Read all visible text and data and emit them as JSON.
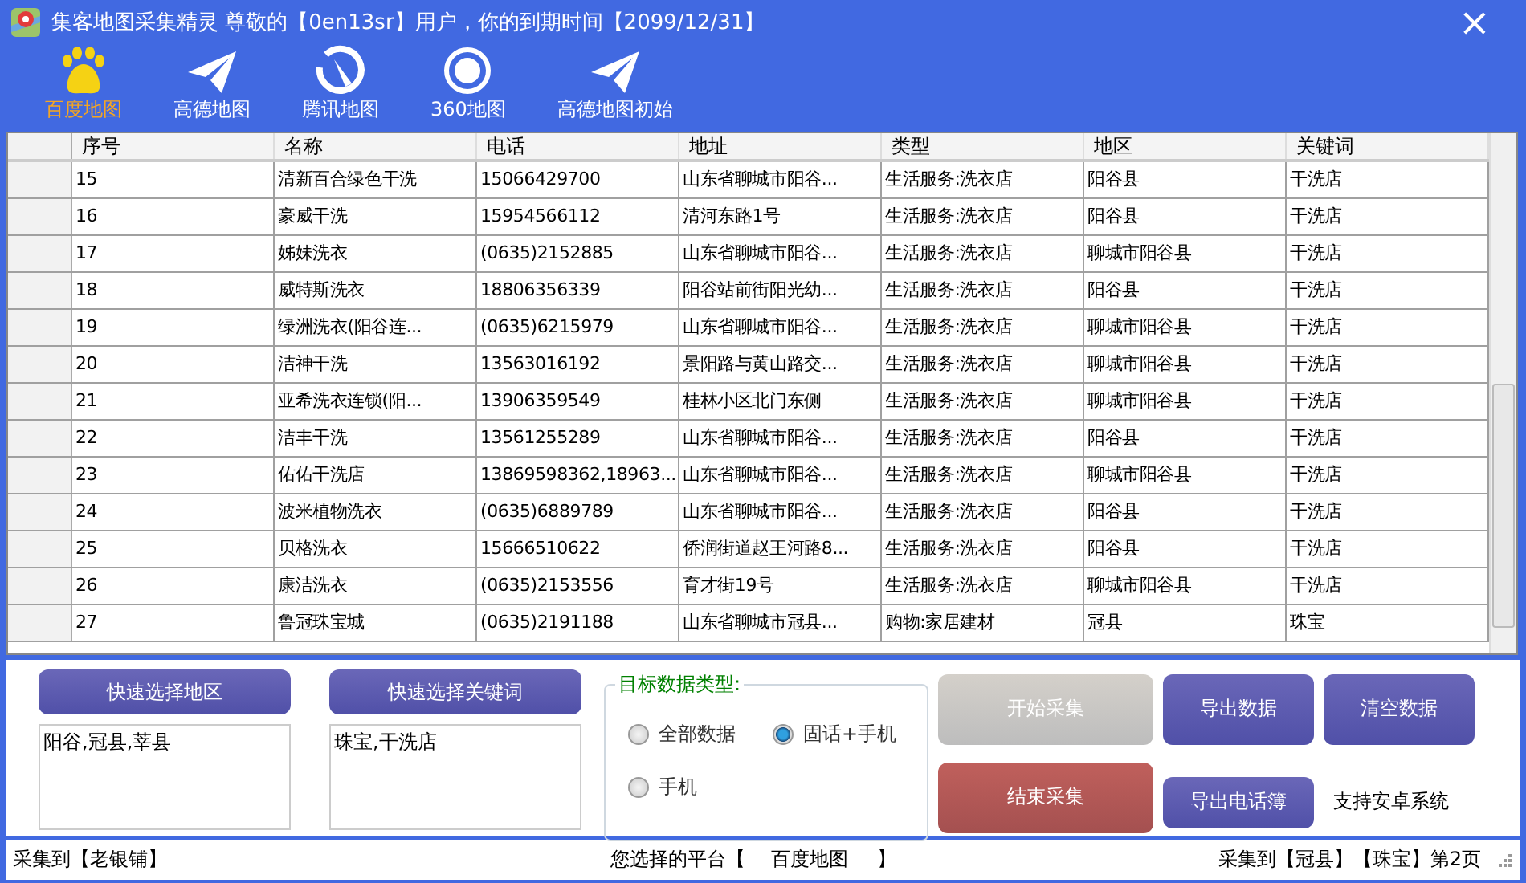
{
  "window": {
    "title": "集客地图采集精灵 尊敬的【0en13sr】用户，你的到期时间【2099/12/31】",
    "close": "×"
  },
  "platforms": [
    {
      "label": "百度地图",
      "selected": true
    },
    {
      "label": "高德地图",
      "selected": false
    },
    {
      "label": "腾讯地图",
      "selected": false
    },
    {
      "label": "360地图",
      "selected": false
    },
    {
      "label": "高德地图初始",
      "selected": false
    }
  ],
  "table": {
    "columns": [
      "序号",
      "名称",
      "电话",
      "地址",
      "类型",
      "地区",
      "关键词"
    ],
    "rows": [
      [
        "15",
        "清新百合绿色干洗",
        "15066429700",
        "山东省聊城市阳谷...",
        "生活服务:洗衣店",
        "阳谷县",
        "干洗店"
      ],
      [
        "16",
        "豪威干洗",
        "15954566112",
        "清河东路1号",
        "生活服务:洗衣店",
        "阳谷县",
        "干洗店"
      ],
      [
        "17",
        "姊妹洗衣",
        "(0635)2152885",
        "山东省聊城市阳谷...",
        "生活服务:洗衣店",
        "聊城市阳谷县",
        "干洗店"
      ],
      [
        "18",
        "威特斯洗衣",
        "18806356339",
        "阳谷站前街阳光幼...",
        "生活服务:洗衣店",
        "阳谷县",
        "干洗店"
      ],
      [
        "19",
        "绿洲洗衣(阳谷连...",
        "(0635)6215979",
        "山东省聊城市阳谷...",
        "生活服务:洗衣店",
        "聊城市阳谷县",
        "干洗店"
      ],
      [
        "20",
        "洁神干洗",
        "13563016192",
        "景阳路与黄山路交...",
        "生活服务:洗衣店",
        "聊城市阳谷县",
        "干洗店"
      ],
      [
        "21",
        "亚希洗衣连锁(阳...",
        "13906359549",
        "桂林小区北门东侧",
        "生活服务:洗衣店",
        "聊城市阳谷县",
        "干洗店"
      ],
      [
        "22",
        "洁丰干洗",
        "13561255289",
        "山东省聊城市阳谷...",
        "生活服务:洗衣店",
        "阳谷县",
        "干洗店"
      ],
      [
        "23",
        "佑佑干洗店",
        "13869598362,18963...",
        "山东省聊城市阳谷...",
        "生活服务:洗衣店",
        "聊城市阳谷县",
        "干洗店"
      ],
      [
        "24",
        "波米植物洗衣",
        "(0635)6889789",
        "山东省聊城市阳谷...",
        "生活服务:洗衣店",
        "阳谷县",
        "干洗店"
      ],
      [
        "25",
        "贝格洗衣",
        "15666510622",
        "侨润街道赵王河路8...",
        "生活服务:洗衣店",
        "阳谷县",
        "干洗店"
      ],
      [
        "26",
        "康洁洗衣",
        "(0635)2153556",
        "育才街19号",
        "生活服务:洗衣店",
        "聊城市阳谷县",
        "干洗店"
      ],
      [
        "27",
        "鲁冠珠宝城",
        "(0635)2191188",
        "山东省聊城市冠县...",
        "购物:家居建材",
        "冠县",
        "珠宝"
      ]
    ]
  },
  "region_button": "快速选择地区",
  "region_value": "阳谷,冠县,莘县",
  "keyword_button": "快速选择关键词",
  "keyword_value": "珠宝,干洗店",
  "data_type": {
    "title": "目标数据类型:",
    "options": [
      {
        "label": "全部数据",
        "selected": false
      },
      {
        "label": "固话+手机",
        "selected": true
      },
      {
        "label": "手机",
        "selected": false
      }
    ]
  },
  "actions": [
    {
      "label": "开始采集",
      "kind": "disabled"
    },
    {
      "label": "导出数据",
      "kind": "primary"
    },
    {
      "label": "清空数据",
      "kind": "primary"
    },
    {
      "label": "结束采集",
      "kind": "danger"
    },
    {
      "label": "导出电话簿",
      "kind": "primary"
    }
  ],
  "note": "支持安卓系统",
  "status_bar": {
    "left": "采集到【老银铺】",
    "platform_label": "您选择的平台【",
    "platform": "百度地图",
    "platform_close": "】",
    "right": "采集到【冠县】【珠宝】第2页"
  }
}
